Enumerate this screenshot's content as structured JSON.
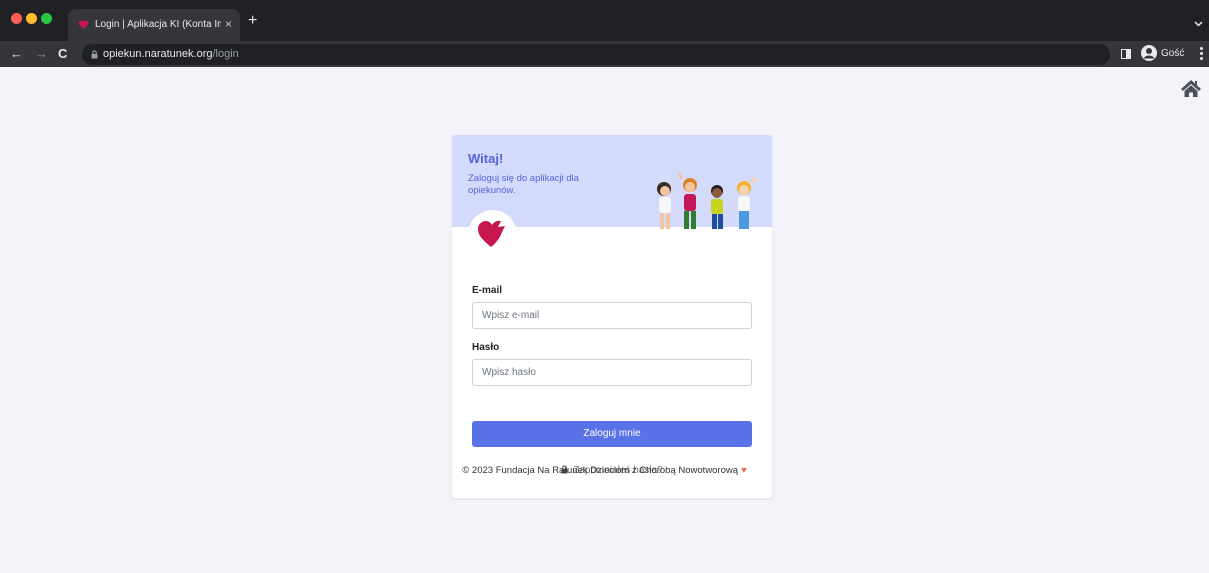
{
  "browser": {
    "tab_title": "Login | Aplikacja KI (Konta Imie",
    "tab_close": "×",
    "new_tab": "+",
    "url_domain": "opiekun.naratunek.org",
    "url_path": "/login",
    "profile_label": "Gość",
    "nav_back": "←",
    "nav_forward": "→",
    "nav_reload": "C"
  },
  "login": {
    "welcome": "Witaj!",
    "subtitle": "Zaloguj się do aplikacji dla opiekunów.",
    "email_label": "E-mail",
    "email_placeholder": "Wpisz e-mail",
    "password_label": "Hasło",
    "password_placeholder": "Wpisz hasło",
    "submit_label": "Zaloguj mnie",
    "forgot_label": "Zapomniałeś hasła?"
  },
  "footer": {
    "text": "© 2023 Fundacja Na Ratunek Dzieciom z Chorobą Nowotworową",
    "heart": "♥"
  },
  "colors": {
    "accent": "#5a72e8",
    "header_bg": "#d4dafa",
    "brand_heart": "#c8174f"
  }
}
